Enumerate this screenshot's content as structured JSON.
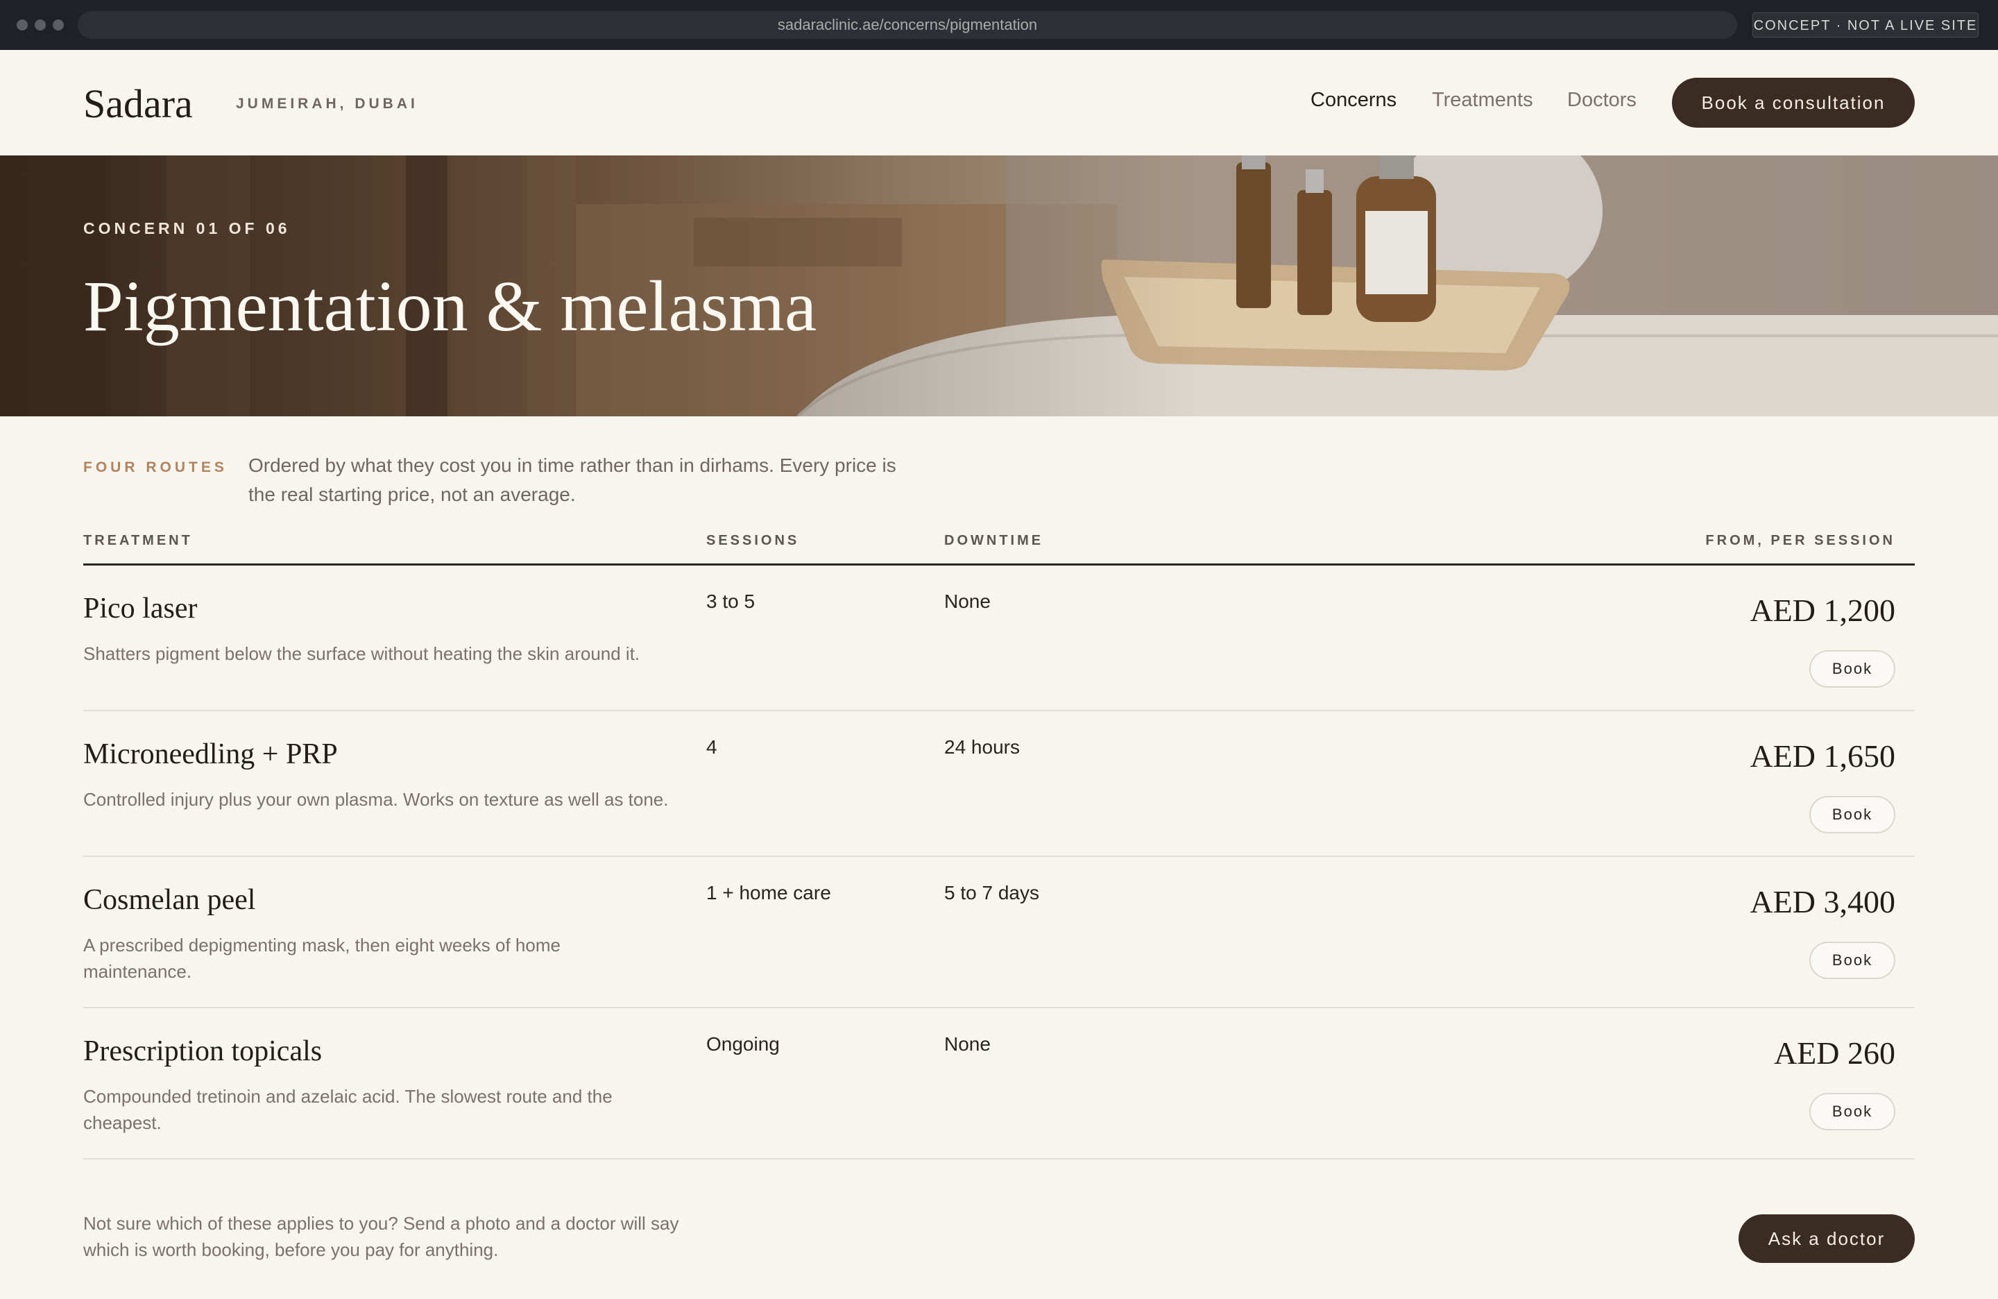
{
  "browser": {
    "url": "sadaraclinic.ae/concerns/pigmentation",
    "badge": "CONCEPT · NOT A LIVE SITE"
  },
  "header": {
    "logo": "Sadara",
    "location": "JUMEIRAH, DUBAI",
    "nav": [
      "Concerns",
      "Treatments",
      "Doctors"
    ],
    "cta": "Book a consultation"
  },
  "hero": {
    "eyebrow": "CONCERN 01 OF 06",
    "title": "Pigmentation & melasma"
  },
  "intro": {
    "label": "FOUR ROUTES",
    "text": "Ordered by what they cost you in time rather than in dirhams. Every price is the real starting price, not an average."
  },
  "table": {
    "headers": {
      "treatment": "TREATMENT",
      "sessions": "SESSIONS",
      "downtime": "DOWNTIME",
      "price": "FROM, PER SESSION"
    },
    "rows": [
      {
        "name": "Pico laser",
        "desc": "Shatters pigment below the surface without heating the skin around it.",
        "sessions": "3 to 5",
        "downtime": "None",
        "price": "AED 1,200",
        "book": "Book"
      },
      {
        "name": "Microneedling + PRP",
        "desc": "Controlled injury plus your own plasma. Works on texture as well as tone.",
        "sessions": "4",
        "downtime": "24 hours",
        "price": "AED 1,650",
        "book": "Book"
      },
      {
        "name": "Cosmelan peel",
        "desc": "A prescribed depigmenting mask, then eight weeks of home maintenance.",
        "sessions": "1 + home care",
        "downtime": "5 to 7 days",
        "price": "AED 3,400",
        "book": "Book"
      },
      {
        "name": "Prescription topicals",
        "desc": "Compounded tretinoin and azelaic acid. The slowest route and the cheapest.",
        "sessions": "Ongoing",
        "downtime": "None",
        "price": "AED 260",
        "book": "Book"
      }
    ]
  },
  "footer": {
    "note": "Not sure which of these applies to you? Send a photo and a doctor will say which is worth booking, before you pay for anything.",
    "cta": "Ask a doctor"
  },
  "colors": {
    "background": "#f8f5ef",
    "primary_button": "#3a2b23",
    "accent": "#b08460"
  }
}
